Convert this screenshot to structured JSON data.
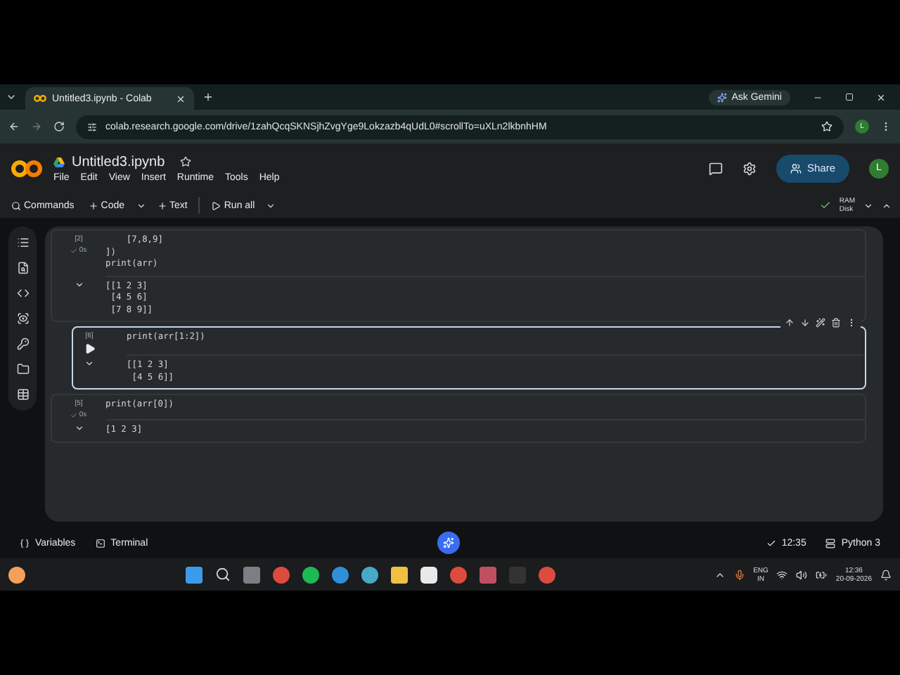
{
  "browser": {
    "tab_title": "Untitled3.ipynb - Colab",
    "ask_gemini": "Ask Gemini",
    "url": "colab.research.google.com/drive/1zahQcqSKNSjhZvgYge9Lokzazb4qUdL0#scrollTo=uXLn2lkbnhHM",
    "profile": "L"
  },
  "notebook": {
    "title": "Untitled3.ipynb",
    "menu": [
      "File",
      "Edit",
      "View",
      "Insert",
      "Runtime",
      "Tools",
      "Help"
    ],
    "share": "Share",
    "avatar": "L"
  },
  "toolbar": {
    "items": [
      {
        "kind": "search",
        "label": "Commands"
      },
      {
        "kind": "add",
        "label": "Code"
      },
      {
        "kind": "add",
        "label": "Text"
      },
      {
        "kind": "run",
        "label": "Run all"
      }
    ],
    "ram": "RAM",
    "disk": "Disk"
  },
  "cells": [
    {
      "exec": "[2]",
      "time": "0s",
      "selected": false,
      "code": [
        "    [7,8,9]",
        "])",
        "print(arr)"
      ],
      "output": [
        "[[1 2 3]",
        " [4 5 6]",
        " [7 8 9]]"
      ]
    },
    {
      "exec": "[6]",
      "selected": true,
      "code": [
        "print(arr[1:2])"
      ],
      "output": [
        "[[1 2 3]",
        " [4 5 6]]"
      ]
    },
    {
      "exec": "[5]",
      "time": "0s",
      "selected": false,
      "code": [
        "print(arr[0])"
      ],
      "output": [
        "[1 2 3]"
      ]
    }
  ],
  "status_bar": {
    "variables": "Variables",
    "terminal": "Terminal",
    "time": "12:35",
    "runtime": "Python 3"
  },
  "taskbar": {
    "lang": "ENG",
    "region": "IN",
    "time": "12:36",
    "date": "20-09-2026"
  }
}
